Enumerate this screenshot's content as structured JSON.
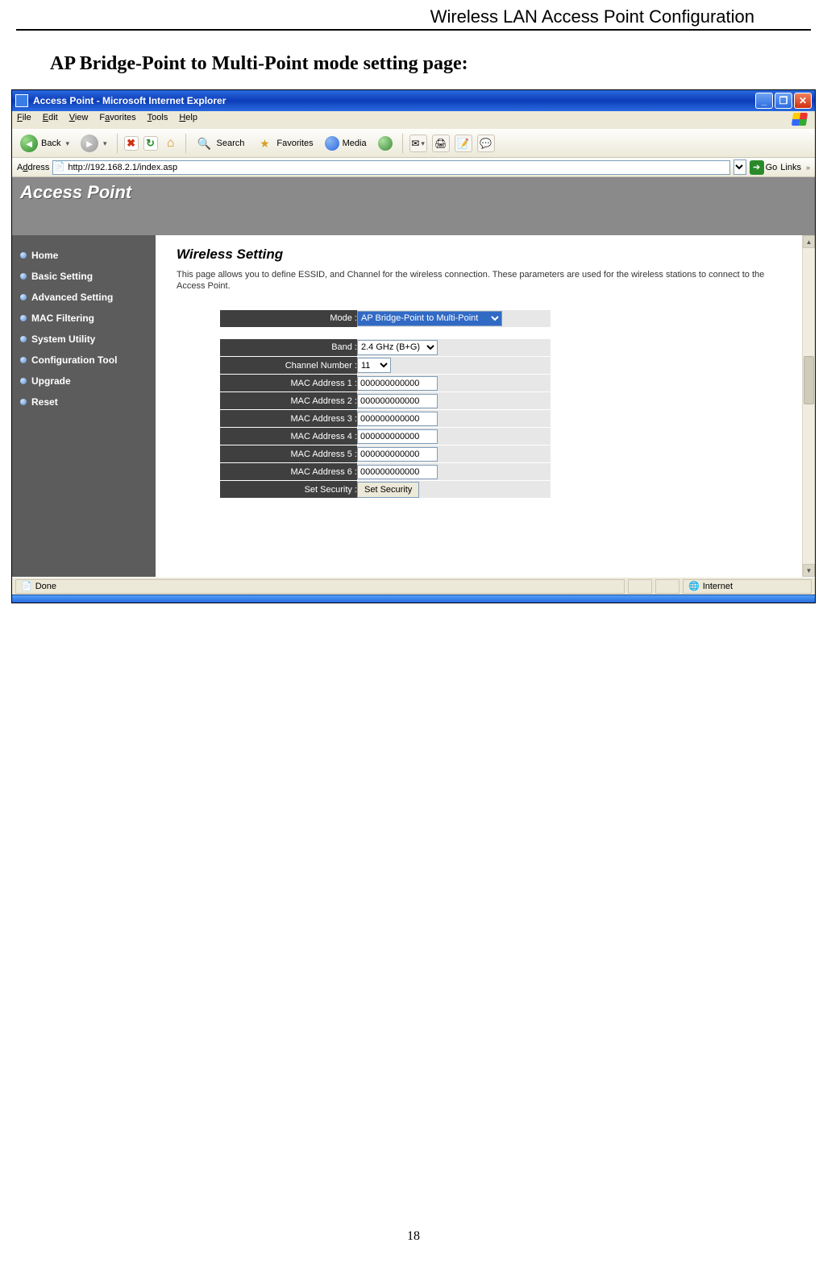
{
  "doc": {
    "header": "Wireless LAN Access Point Configuration",
    "title": "AP Bridge-Point to Multi-Point mode setting page:",
    "page_number": "18"
  },
  "window": {
    "title": "Access Point - Microsoft Internet Explorer"
  },
  "menu": {
    "file": "File",
    "edit": "Edit",
    "view": "View",
    "favorites": "Favorites",
    "tools": "Tools",
    "help": "Help"
  },
  "toolbar": {
    "back": "Back",
    "search": "Search",
    "favorites": "Favorites",
    "media": "Media"
  },
  "addressbar": {
    "label": "Address",
    "url": "http://192.168.2.1/index.asp",
    "go": "Go",
    "links": "Links"
  },
  "banner": {
    "title": "Access Point"
  },
  "sidebar": {
    "items": [
      {
        "label": "Home"
      },
      {
        "label": "Basic Setting"
      },
      {
        "label": "Advanced Setting"
      },
      {
        "label": "MAC Filtering"
      },
      {
        "label": "System Utility"
      },
      {
        "label": "Configuration Tool"
      },
      {
        "label": "Upgrade"
      },
      {
        "label": "Reset"
      }
    ]
  },
  "page": {
    "heading": "Wireless Setting",
    "desc": "This page allows you to define ESSID, and Channel for the wireless connection. These parameters are used for the wireless stations to connect to the Access Point."
  },
  "form": {
    "mode_label": "Mode :",
    "mode_value": "AP Bridge-Point to Multi-Point",
    "band_label": "Band :",
    "band_value": "2.4 GHz (B+G)",
    "channel_label": "Channel Number :",
    "channel_value": "11",
    "mac1_label": "MAC Address 1 :",
    "mac2_label": "MAC Address 2 :",
    "mac3_label": "MAC Address 3 :",
    "mac4_label": "MAC Address 4 :",
    "mac5_label": "MAC Address 5 :",
    "mac6_label": "MAC Address 6 :",
    "mac_value": "000000000000",
    "security_label": "Set Security :",
    "security_button": "Set Security"
  },
  "status": {
    "done": "Done",
    "zone": "Internet"
  }
}
